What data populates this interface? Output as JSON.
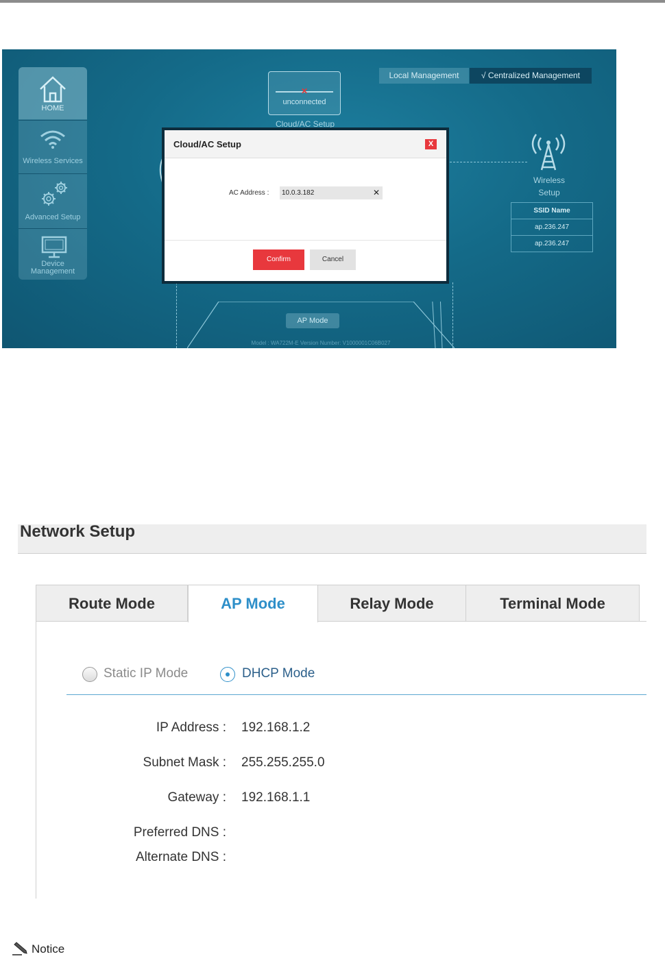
{
  "screenshot1": {
    "sidebar": {
      "items": [
        {
          "label": "HOME",
          "icon": "home-icon"
        },
        {
          "label": "Wireless Services",
          "icon": "wifi-icon"
        },
        {
          "label": "Advanced Setup",
          "icon": "gears-icon"
        },
        {
          "label_line1": "Device",
          "label_line2": "Management",
          "icon": "monitor-icon"
        }
      ]
    },
    "cloud": {
      "status": "unconnected",
      "label": "Cloud/AC Setup"
    },
    "management": {
      "local": "Local Management",
      "centralized": "√ Centralized Management"
    },
    "wireless": {
      "label_line1": "Wireless",
      "label_line2": "Setup"
    },
    "ssid_table": {
      "header": "SSID Name",
      "rows": [
        "ap.236.247",
        "ap.236.247"
      ]
    },
    "ap_mode_badge": "AP Mode",
    "model_text": "Model : WA722M-E Version Number: V1000001C06B027",
    "dialog": {
      "title": "Cloud/AC Setup",
      "close": "X",
      "ac_label": "AC Address :",
      "ac_value": "10.0.3.182",
      "clear": "✕",
      "confirm": "Confirm",
      "cancel": "Cancel"
    },
    "colors": {
      "accent_red": "#e8383d",
      "background_teal": "#146a88"
    }
  },
  "screenshot2": {
    "title": "Network Setup",
    "tabs": [
      {
        "label": "Route Mode",
        "active": false
      },
      {
        "label": "AP Mode",
        "active": true
      },
      {
        "label": "Relay Mode",
        "active": false
      },
      {
        "label": "Terminal Mode",
        "active": false
      }
    ],
    "radios": [
      {
        "label": "Static IP Mode",
        "selected": false
      },
      {
        "label": "DHCP Mode",
        "selected": true
      }
    ],
    "fields": [
      {
        "label": "IP Address :",
        "value": "192.168.1.2"
      },
      {
        "label": "Subnet Mask :",
        "value": "255.255.255.0"
      },
      {
        "label": "Gateway :",
        "value": "192.168.1.1"
      },
      {
        "label": "Preferred DNS :",
        "value": ""
      },
      {
        "label": "Alternate DNS :",
        "value": ""
      }
    ],
    "colors": {
      "accent_blue": "#2e8fc9"
    }
  },
  "notice": {
    "label": "Notice",
    "icon": "pencil-icon"
  }
}
